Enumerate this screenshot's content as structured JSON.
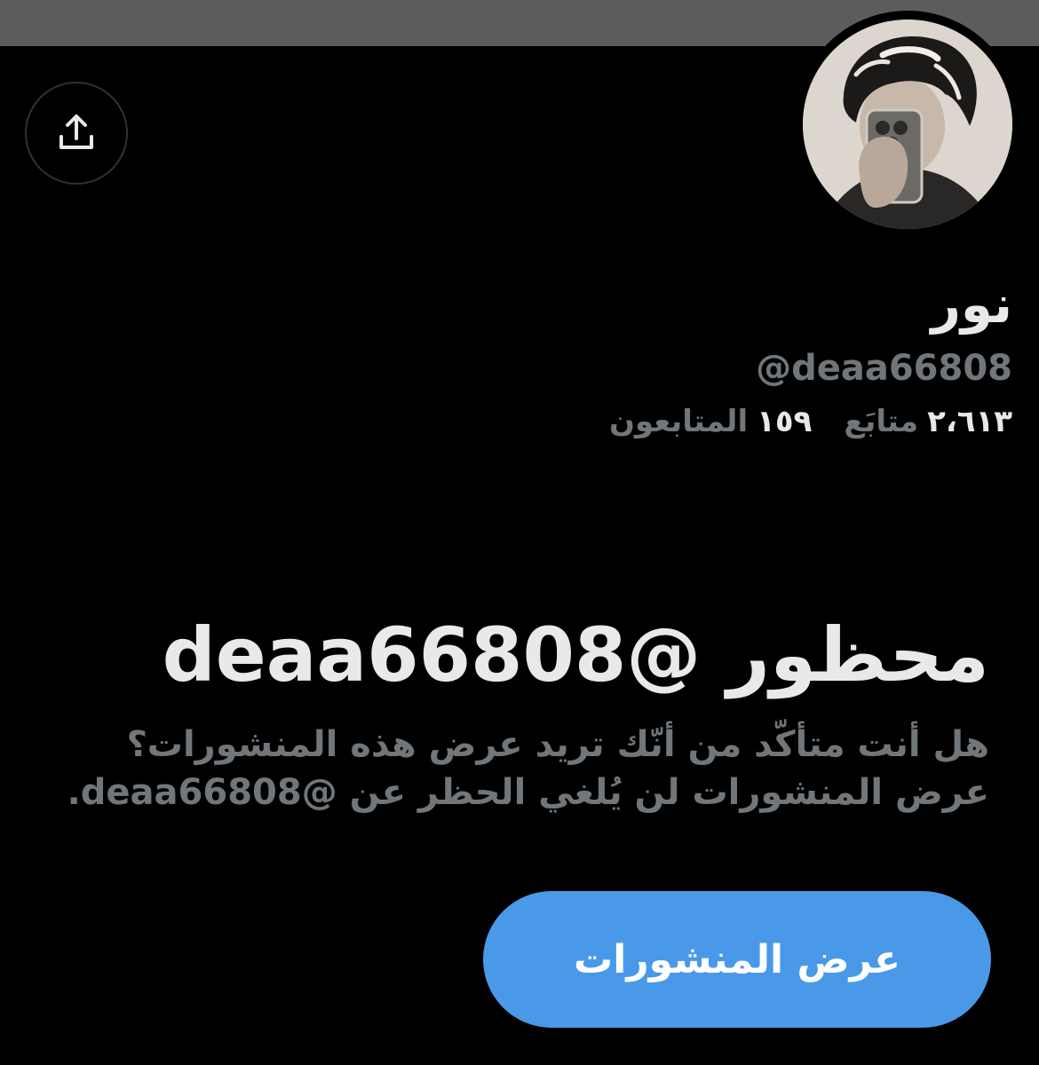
{
  "profile": {
    "display_name": "نور",
    "handle": "@deaa66808",
    "stats": [
      {
        "value": "٢،٦١٣",
        "label": "متابَع"
      },
      {
        "value": "١٥٩",
        "label": "المتابعون"
      }
    ]
  },
  "blocked": {
    "title": "محظور @deaa66808",
    "body_line1": "هل أنت متأكّد من أنّك تريد عرض هذه المنشورات؟",
    "body_line2": "عرض المنشورات لن يُلغي الحظر عن @deaa66808."
  },
  "actions": {
    "view_posts_label": "عرض المنشورات",
    "share_icon": "share-upload-icon"
  },
  "colors": {
    "background": "#000000",
    "banner": "#5c5c5c",
    "primary_text": "#e7e9ea",
    "secondary_text": "#71767b",
    "accent_button": "#4a99e9"
  }
}
